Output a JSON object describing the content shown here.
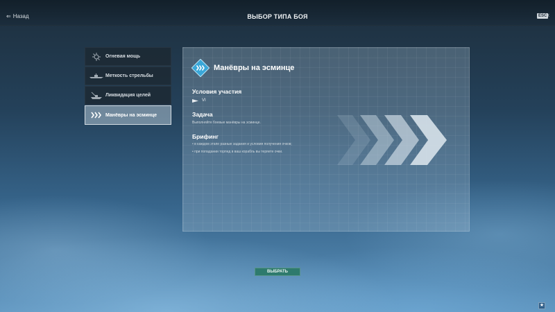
{
  "header": {
    "back_label": "Назад",
    "title": "ВЫБОР ТИПА БОЯ",
    "esc_label": "ESC"
  },
  "menu": {
    "items": [
      {
        "label": "Огневая мощь",
        "icon": "firepower-icon"
      },
      {
        "label": "Меткость стрельбы",
        "icon": "ship-icon"
      },
      {
        "label": "Ликвидация целей",
        "icon": "target-ship-icon"
      },
      {
        "label": "Манёвры на эсминце",
        "icon": "chevrons-icon",
        "active": true
      }
    ]
  },
  "panel": {
    "title": "Манёвры на эсминце",
    "conditions_heading": "Условия участия",
    "tier": "VI",
    "task_heading": "Задача",
    "task_text": "Выполняйте боевые манёвры на эсминце.",
    "briefing_heading": "Брифинг",
    "briefing": [
      "в каждом этапе разные задания и условия получения очков;",
      "при попадании торпед в ваш корабль вы теряете очки."
    ]
  },
  "footer": {
    "select_label": "ВЫБРАТЬ"
  },
  "colors": {
    "accent": "#2e7a6d",
    "badge": "#3aa7d8"
  }
}
